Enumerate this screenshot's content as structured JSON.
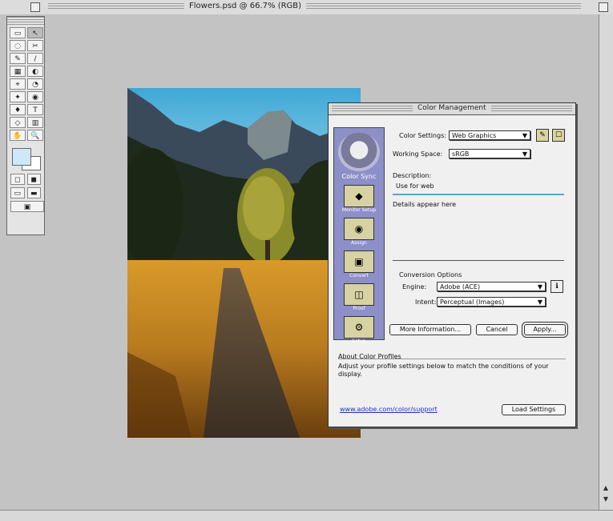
{
  "window": {
    "title": "Flowers.psd @ 66.7% (RGB)"
  },
  "toolbox": {
    "tools": [
      "▭",
      "↖",
      "◌",
      "✂",
      "✎",
      "/",
      "▦",
      "◐",
      "⌖",
      "◔",
      "✦",
      "◉",
      "♦",
      "T",
      "◇",
      "▥",
      "✋",
      "🔍"
    ],
    "mode_labels": [
      "",
      "",
      ""
    ]
  },
  "dialog": {
    "title": "Color Management",
    "sidebar": {
      "brand": "Color Sync",
      "items": [
        {
          "icon": "◆",
          "label": "Monitor Setup"
        },
        {
          "icon": "◉",
          "label": "Assign"
        },
        {
          "icon": "▣",
          "label": "Convert"
        },
        {
          "icon": "◫",
          "label": "Proof"
        },
        {
          "icon": "⚙",
          "label": "Setup"
        }
      ]
    },
    "source_label": "Color Settings:",
    "source_value": "Web Graphics",
    "working_label": "Working Space:",
    "working_value": "sRGB",
    "desc_header": "Description:",
    "desc_line": "Use for web",
    "details": "Details appear here",
    "engine_section": "Conversion Options",
    "engine_label": "Engine:",
    "engine_value": "Adobe (ACE)",
    "intent_label": "Intent:",
    "intent_value": "Perceptual (Images)",
    "buttons": {
      "more": "More Information...",
      "cancel": "Cancel",
      "apply": "Apply..."
    },
    "footer_header": "About Color Profiles",
    "footer_text": "Adjust your profile settings below to match the conditions of your display.",
    "link_text": "www.adobe.com/color/support",
    "ok_button": "Load Settings"
  },
  "colors": {
    "sidebar": "#8d8fc8",
    "accent": "#2233aa"
  }
}
